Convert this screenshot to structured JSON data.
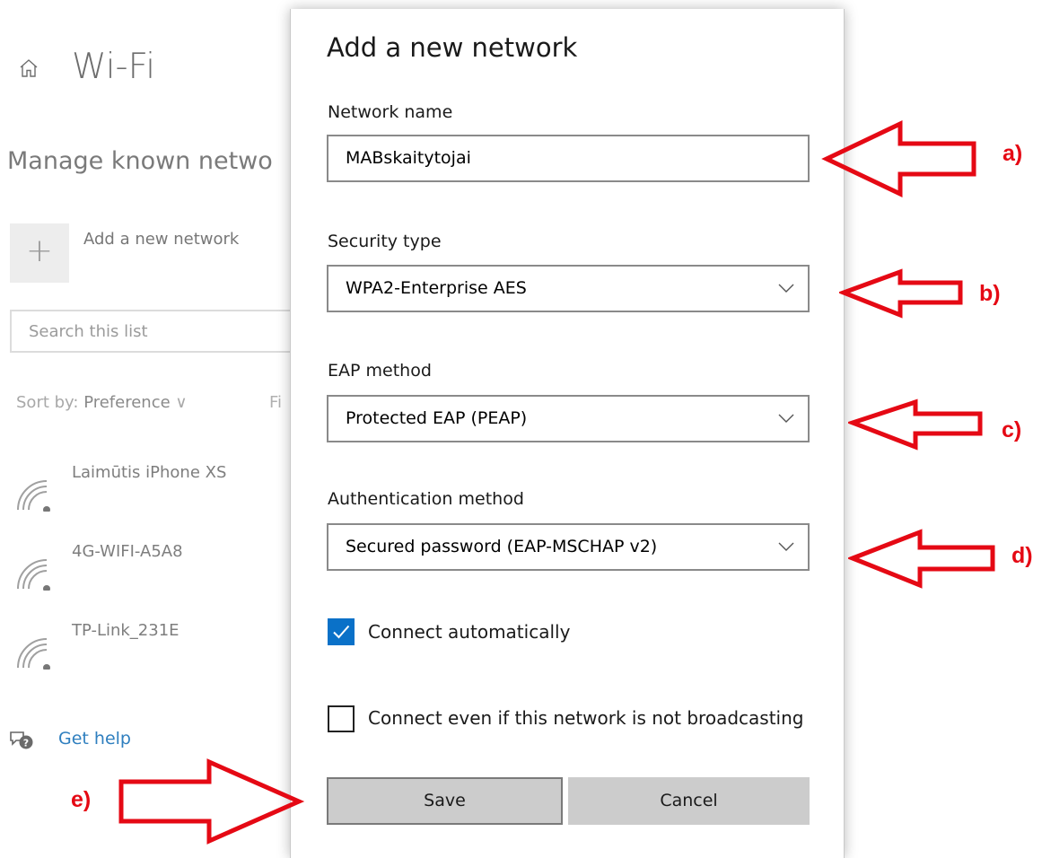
{
  "background": {
    "title": "Wi-Fi",
    "section_heading": "Manage known netwo",
    "add_network_label": "Add a new network",
    "add_symbol": "+",
    "search_placeholder": "Search this list",
    "sort_label": "Sort by:",
    "sort_value": "Preference",
    "sort_chevron": "∨",
    "filter_partial": "Fi",
    "networks": [
      {
        "name": "Laimūtis iPhone XS",
        "icon": "wifi-icon"
      },
      {
        "name": "4G-WIFI-A5A8",
        "icon": "wifi-icon"
      },
      {
        "name": "TP-Link_231E",
        "icon": "wifi-icon"
      }
    ],
    "help_label": "Get help"
  },
  "dialog": {
    "title": "Add a new network",
    "network_name_label": "Network name",
    "network_name_value": "MABskaitytojai",
    "security_type_label": "Security type",
    "security_type_value": "WPA2-Enterprise AES",
    "eap_method_label": "EAP method",
    "eap_method_value": "Protected EAP (PEAP)",
    "auth_method_label": "Authentication method",
    "auth_method_value": "Secured password (EAP-MSCHAP v2)",
    "connect_auto_label": "Connect automatically",
    "connect_auto_checked": true,
    "connect_hidden_label": "Connect even if this network is not broadcasting",
    "connect_hidden_checked": false,
    "save_label": "Save",
    "cancel_label": "Cancel"
  },
  "annotations": {
    "a": "a)",
    "b": "b)",
    "c": "c)",
    "d": "d)",
    "e": "e)",
    "color": "#e50914"
  },
  "colors": {
    "accent": "#0a71c8",
    "link": "#2f7fbf",
    "button_bg": "#cccccc"
  }
}
